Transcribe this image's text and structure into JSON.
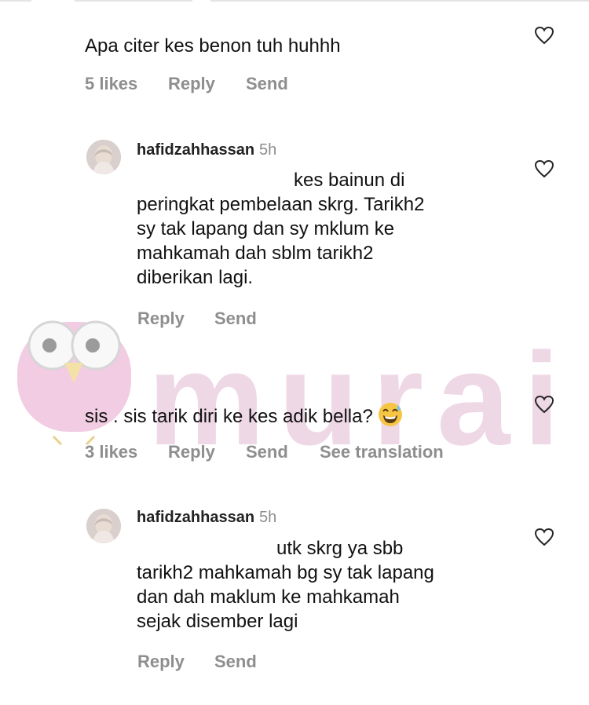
{
  "watermark": {
    "text": "murai"
  },
  "threads": [
    {
      "text": "Apa citer kes benon tuh huhhh",
      "likes": "5 likes",
      "reply_label": "Reply",
      "send_label": "Send",
      "replies": [
        {
          "username": "hafidzahhassan",
          "time": "5h",
          "lines": [
            "kes bainun di",
            "peringkat pembelaan skrg. Tarikh2",
            "sy tak lapang dan sy mklum ke",
            "mahkamah dah sblm tarikh2",
            "diberikan lagi."
          ],
          "reply_label": "Reply",
          "send_label": "Send"
        }
      ]
    },
    {
      "text": "sis . sis tarik diri ke kes adik bella?",
      "emoji": "grinning-sweat-emoji",
      "likes": "3 likes",
      "reply_label": "Reply",
      "send_label": "Send",
      "translate_label": "See translation",
      "replies": [
        {
          "username": "hafidzahhassan",
          "time": "5h",
          "lines": [
            "utk skrg ya sbb",
            "tarikh2 mahkamah bg sy tak lapang",
            "dan dah maklum ke mahkamah",
            "sejak disember lagi"
          ],
          "reply_label": "Reply",
          "send_label": "Send"
        }
      ]
    }
  ],
  "colors": {
    "text": "#111111",
    "meta": "#8e8e8e",
    "watermark": "#e9c8dc"
  }
}
